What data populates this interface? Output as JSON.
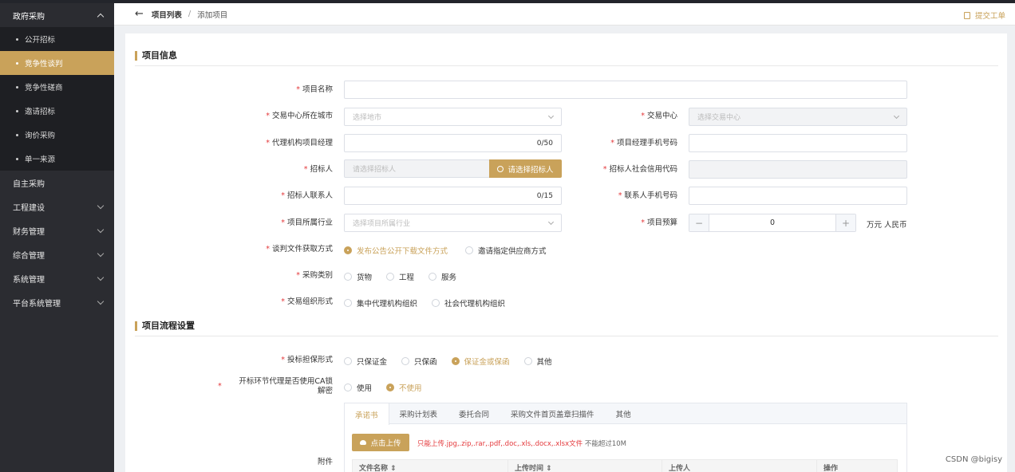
{
  "sidebar": {
    "groups": [
      {
        "label": "政府采购",
        "open": true
      },
      {
        "label": "自主采购"
      },
      {
        "label": "工程建设"
      },
      {
        "label": "财务管理"
      },
      {
        "label": "综合管理"
      },
      {
        "label": "系统管理"
      },
      {
        "label": "平台系统管理"
      }
    ],
    "sub_items": [
      "公开招标",
      "竞争性谈判",
      "竞争性磋商",
      "邀请招标",
      "询价采购",
      "单一来源"
    ],
    "active_sub": "竞争性谈判"
  },
  "header": {
    "back_icon": "arrow-left-icon",
    "crumb_parent": "项目列表",
    "crumb_separator": "/",
    "crumb_current": "添加项目",
    "submit_ticket": "提交工单"
  },
  "sections": {
    "project_info": "项目信息",
    "process_settings": "项目流程设置"
  },
  "form": {
    "project_name": {
      "label": "项目名称",
      "value": ""
    },
    "city": {
      "label": "交易中心所在城市",
      "placeholder": "选择地市"
    },
    "center": {
      "label": "交易中心",
      "placeholder": "选择交易中心"
    },
    "agent_manager": {
      "label": "代理机构项目经理",
      "count": "0/50"
    },
    "manager_phone": {
      "label": "项目经理手机号码"
    },
    "tenderer": {
      "label": "招标人",
      "placeholder": "请选择招标人",
      "button": "请选择招标人"
    },
    "credit_code": {
      "label": "招标人社会信用代码"
    },
    "tenderer_contact": {
      "label": "招标人联系人",
      "count": "0/15"
    },
    "contact_phone": {
      "label": "联系人手机号码"
    },
    "industry": {
      "label": "项目所属行业",
      "placeholder": "选择项目所属行业"
    },
    "budget": {
      "label": "项目预算",
      "value": "0",
      "minus": "−",
      "plus": "+",
      "unit": "万元 人民币"
    },
    "doc_method": {
      "label": "谈判文件获取方式",
      "options": [
        "发布公告公开下载文件方式",
        "邀请指定供应商方式"
      ],
      "selected": 0
    },
    "purchase_type": {
      "label": "采购类别",
      "options": [
        "货物",
        "工程",
        "服务"
      ]
    },
    "org_form": {
      "label": "交易组织形式",
      "options": [
        "集中代理机构组织",
        "社会代理机构组织"
      ]
    },
    "guarantee": {
      "label": "投标担保形式",
      "options": [
        "只保证金",
        "只保函",
        "保证金或保函",
        "其他"
      ],
      "selected": 2
    },
    "ca_lock": {
      "label_line1": "开标环节代理是否使用CA锁",
      "label_line2": "解密",
      "options": [
        "使用",
        "不使用"
      ],
      "selected": 1
    },
    "attachment": {
      "label": "附件"
    }
  },
  "attachments": {
    "tabs": [
      "承诺书",
      "采购计划表",
      "委托合同",
      "采购文件首页盖章扫描件",
      "其他"
    ],
    "active_tab": 0,
    "upload_button": "点击上传",
    "hint": "只能上传.jpg,.zip,.rar,.pdf,.doc,.xls,.docx,.xlsx文件",
    "hint_size": "不能超过10M",
    "columns": [
      "文件名称 ⇕",
      "上传时间 ⇕",
      "上传人",
      "操作"
    ]
  },
  "watermark": "CSDN @bigisy",
  "colors": {
    "accent": "#c9a25a",
    "sidebar": "#2b2c31",
    "required": "#e4393c"
  }
}
